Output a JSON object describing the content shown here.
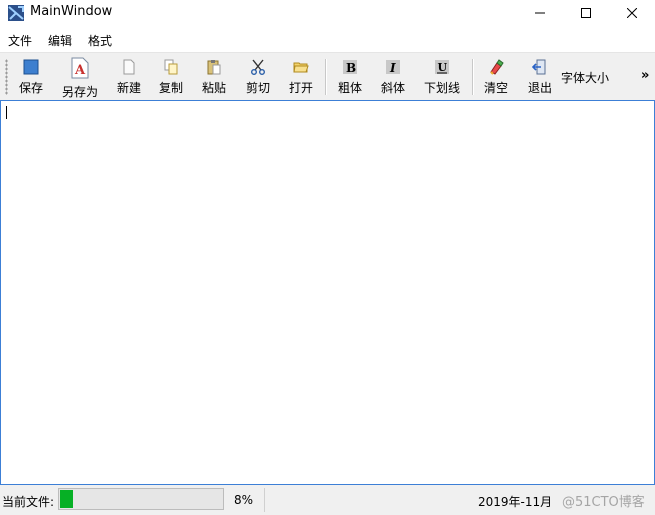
{
  "window": {
    "title": "MainWindow"
  },
  "menu": [
    "文件",
    "编辑",
    "格式"
  ],
  "toolbar": {
    "buttons": [
      {
        "label": "保存",
        "icon": "save-icon"
      },
      {
        "label": "另存为",
        "icon": "save-as-icon"
      },
      {
        "label": "新建",
        "icon": "new-file-icon"
      },
      {
        "label": "复制",
        "icon": "copy-icon"
      },
      {
        "label": "粘贴",
        "icon": "paste-icon"
      },
      {
        "label": "剪切",
        "icon": "cut-icon"
      },
      {
        "label": "打开",
        "icon": "open-folder-icon"
      },
      {
        "label": "粗体",
        "icon": "bold-icon"
      },
      {
        "label": "斜体",
        "icon": "italic-icon"
      },
      {
        "label": "下划线",
        "icon": "underline-icon"
      },
      {
        "label": "清空",
        "icon": "clear-icon"
      },
      {
        "label": "退出",
        "icon": "exit-icon"
      }
    ],
    "font_size_label": "字体大小",
    "overflow": "»"
  },
  "editor": {
    "content": ""
  },
  "status": {
    "current_file_label": "当前文件:",
    "progress": 0.08,
    "percent_text": "8%",
    "datetime": "2019年-11月",
    "watermark": "@51CTO博客"
  },
  "colors": {
    "progress_fill": "#06b025",
    "editor_border": "#3c7fd6",
    "toolbar_bg": "#f0f0f0"
  }
}
